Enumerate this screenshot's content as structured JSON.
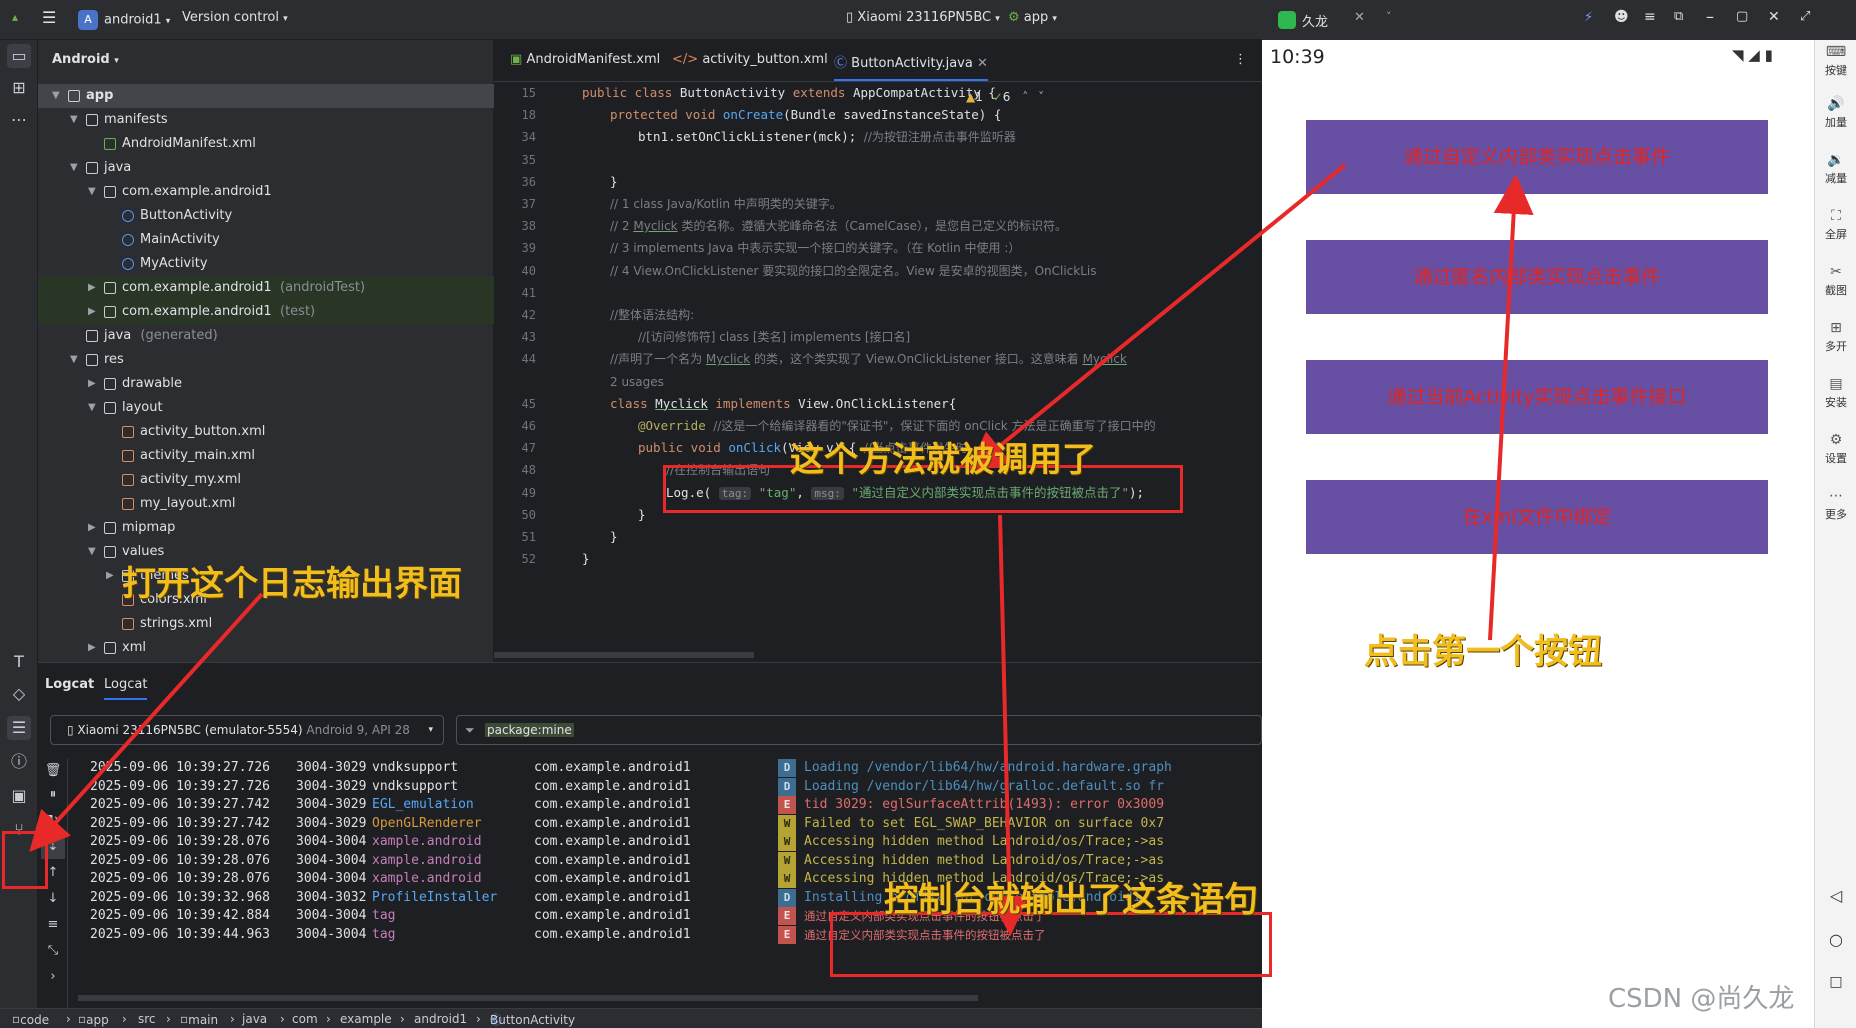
{
  "ide": {
    "project_name": "android1",
    "project_badge": "A",
    "version_control": "Version control",
    "device": "Xiaomi 23116PN5BC",
    "run_config": "app"
  },
  "project_panel": {
    "header": "Android",
    "tree": [
      {
        "label": "app",
        "extra": "",
        "indent": 0,
        "arrow": "open",
        "icon": "folder",
        "selected": true,
        "test": false
      },
      {
        "label": "manifests",
        "extra": "",
        "indent": 1,
        "arrow": "open",
        "icon": "folder",
        "selected": false,
        "test": false
      },
      {
        "label": "AndroidManifest.xml",
        "extra": "",
        "indent": 2,
        "arrow": "",
        "icon": "mf",
        "selected": false,
        "test": false
      },
      {
        "label": "java",
        "extra": "",
        "indent": 1,
        "arrow": "open",
        "icon": "folder",
        "selected": false,
        "test": false
      },
      {
        "label": "com.example.android1",
        "extra": "",
        "indent": 2,
        "arrow": "open",
        "icon": "folder",
        "selected": false,
        "test": false
      },
      {
        "label": "ButtonActivity",
        "extra": "",
        "indent": 3,
        "arrow": "",
        "icon": "cls",
        "selected": false,
        "test": false
      },
      {
        "label": "MainActivity",
        "extra": "",
        "indent": 3,
        "arrow": "",
        "icon": "cls",
        "selected": false,
        "test": false
      },
      {
        "label": "MyActivity",
        "extra": "",
        "indent": 3,
        "arrow": "",
        "icon": "cls",
        "selected": false,
        "test": false
      },
      {
        "label": "com.example.android1",
        "extra": "(androidTest)",
        "indent": 2,
        "arrow": "closed",
        "icon": "folder",
        "selected": false,
        "test": true
      },
      {
        "label": "com.example.android1",
        "extra": "(test)",
        "indent": 2,
        "arrow": "closed",
        "icon": "folder",
        "selected": false,
        "test": true
      },
      {
        "label": "java",
        "extra": "(generated)",
        "indent": 1,
        "arrow": "",
        "icon": "folder",
        "selected": false,
        "test": false
      },
      {
        "label": "res",
        "extra": "",
        "indent": 1,
        "arrow": "open",
        "icon": "folder",
        "selected": false,
        "test": false
      },
      {
        "label": "drawable",
        "extra": "",
        "indent": 2,
        "arrow": "closed",
        "icon": "folder",
        "selected": false,
        "test": false
      },
      {
        "label": "layout",
        "extra": "",
        "indent": 2,
        "arrow": "open",
        "icon": "folder",
        "selected": false,
        "test": false
      },
      {
        "label": "activity_button.xml",
        "extra": "",
        "indent": 3,
        "arrow": "",
        "icon": "xml",
        "selected": false,
        "test": false
      },
      {
        "label": "activity_main.xml",
        "extra": "",
        "indent": 3,
        "arrow": "",
        "icon": "xml",
        "selected": false,
        "test": false
      },
      {
        "label": "activity_my.xml",
        "extra": "",
        "indent": 3,
        "arrow": "",
        "icon": "xml",
        "selected": false,
        "test": false
      },
      {
        "label": "my_layout.xml",
        "extra": "",
        "indent": 3,
        "arrow": "",
        "icon": "xml",
        "selected": false,
        "test": false
      },
      {
        "label": "mipmap",
        "extra": "",
        "indent": 2,
        "arrow": "closed",
        "icon": "folder",
        "selected": false,
        "test": false
      },
      {
        "label": "values",
        "extra": "",
        "indent": 2,
        "arrow": "open",
        "icon": "folder",
        "selected": false,
        "test": false
      },
      {
        "label": "themes",
        "extra": "",
        "indent": 3,
        "arrow": "closed",
        "icon": "folder",
        "selected": false,
        "test": false
      },
      {
        "label": "colors.xml",
        "extra": "",
        "indent": 3,
        "arrow": "",
        "icon": "xml",
        "selected": false,
        "test": false
      },
      {
        "label": "strings.xml",
        "extra": "",
        "indent": 3,
        "arrow": "",
        "icon": "xml",
        "selected": false,
        "test": false
      },
      {
        "label": "xml",
        "extra": "",
        "indent": 2,
        "arrow": "closed",
        "icon": "folder",
        "selected": false,
        "test": false
      }
    ]
  },
  "editor": {
    "tabs": [
      "AndroidManifest.xml",
      "activity_button.xml",
      "ButtonActivity.java"
    ],
    "active_tab": 2,
    "inspections": {
      "warnings": "1",
      "ok": "6"
    },
    "lines": [
      {
        "n": "15",
        "html": "<span class='kw'>public class</span> ButtonActivity <span class='kw'>extends</span> AppCompatActivity {",
        "indent": 0
      },
      {
        "n": "18",
        "html": "<span class='kw'>protected void</span> <span class='fn'>onCreate</span>(Bundle savedInstanceState) {",
        "indent": 1
      },
      {
        "n": "34",
        "html": "btn1.setOnClickListener(mck);  <span class='cmtext'>//为按钮注册点击事件监听器</span>",
        "indent": 2
      },
      {
        "n": "35",
        "html": "",
        "indent": 0
      },
      {
        "n": "36",
        "html": "}",
        "indent": 1
      },
      {
        "n": "37",
        "html": "<span class='cmtext'>// 1    class   Java/Kotlin 中声明类的关键字。</span>",
        "indent": 1
      },
      {
        "n": "38",
        "html": "<span class='cmtext'>// 2    <span class='ul'>Myclick</span> 类的名称。遵循大驼峰命名法（CamelCase），是您自己定义的标识符。</span>",
        "indent": 1
      },
      {
        "n": "39",
        "html": "<span class='cmtext'>// 3    implements  Java 中表示实现一个接口的关键字。（在 Kotlin 中使用 :）</span>",
        "indent": 1
      },
      {
        "n": "40",
        "html": "<span class='cmtext'>// 4    View.OnClickListener    要实现的接口的全限定名。View 是安卓的视图类，OnClickLis</span>",
        "indent": 1
      },
      {
        "n": "41",
        "html": "",
        "indent": 0
      },
      {
        "n": "42",
        "html": "<span class='cmtext'>//整体语法结构:</span>",
        "indent": 1
      },
      {
        "n": "43",
        "html": "<span class='cmtext'>//[访问修饰符] class [类名] implements [接口名]</span>",
        "indent": 2
      },
      {
        "n": "44",
        "html": "<span class='cmtext'>//声明了一个名为 <span class='ul'>Myclick</span> 的类，这个类实现了 View.OnClickListener 接口。这意味着 <span class='ul'>Myclick</span></span>",
        "indent": 1
      },
      {
        "n": "",
        "html": "<span class='cmtext'>2 usages</span>",
        "indent": 1
      },
      {
        "n": "45",
        "html": "<span class='kw'>class</span> <span class='ul'>Myclick</span> <span class='kw'>implements</span> View.OnClickListener{",
        "indent": 1
      },
      {
        "n": "46",
        "html": "<span class='an'>@Override</span>  <span class='cmtext'>//这是一个给编译器看的\"保证书\"，保证下面的 onClick 方法是正确重写了接口中的</span>",
        "indent": 2
      },
      {
        "n": "47",
        "html": "<span class='kw'>public void</span> <span class='fn'>onClick</span>(View v) {  <span class='cmtext'>//当点击事件发生时，我会</span>",
        "indent": 2
      },
      {
        "n": "48",
        "html": "<span class='cmtext'>//在控制台输出语句</span>",
        "indent": 3
      },
      {
        "n": "49",
        "html": "Log.e( <span class='hint'>tag:</span> <span class='str'>\"tag\"</span>, <span class='hint'>msg:</span> <span class='str'>\"通过自定义内部类实现点击事件的按钮被点击了\"</span>);",
        "indent": 3
      },
      {
        "n": "50",
        "html": "}",
        "indent": 2
      },
      {
        "n": "51",
        "html": "}",
        "indent": 1
      },
      {
        "n": "52",
        "html": "}",
        "indent": 0
      }
    ]
  },
  "logcat": {
    "tabs": [
      "Logcat",
      "Logcat"
    ],
    "device": "Xiaomi 23116PN5BC (emulator-5554)",
    "device_extra": "Android 9, API 28",
    "filter": "package:mine",
    "rows": [
      {
        "time": "2025-09-06 10:39:27.726",
        "pid": "3004-3029",
        "tag": "vndksupport",
        "tagc": "plain",
        "pkg": "com.example.android1",
        "lvl": "D",
        "msg": "Loading /vendor/lib64/hw/android.hardware.graph"
      },
      {
        "time": "2025-09-06 10:39:27.726",
        "pid": "3004-3029",
        "tag": "vndksupport",
        "tagc": "plain",
        "pkg": "com.example.android1",
        "lvl": "D",
        "msg": "Loading /vendor/lib64/hw/gralloc.default.so fr"
      },
      {
        "time": "2025-09-06 10:39:27.742",
        "pid": "3004-3029",
        "tag": "EGL_emulation",
        "tagc": "blue",
        "pkg": "com.example.android1",
        "lvl": "E",
        "msg": "tid 3029: eglSurfaceAttrib(1493): error 0x3009"
      },
      {
        "time": "2025-09-06 10:39:27.742",
        "pid": "3004-3029",
        "tag": "OpenGLRenderer",
        "tagc": "orange",
        "pkg": "com.example.android1",
        "lvl": "W",
        "msg": "Failed to set EGL_SWAP_BEHAVIOR on surface 0x7"
      },
      {
        "time": "2025-09-06 10:39:28.076",
        "pid": "3004-3004",
        "tag": "xample.android",
        "tagc": "purple",
        "pkg": "com.example.android1",
        "lvl": "W",
        "msg": "Accessing hidden method Landroid/os/Trace;->as"
      },
      {
        "time": "2025-09-06 10:39:28.076",
        "pid": "3004-3004",
        "tag": "xample.android",
        "tagc": "purple",
        "pkg": "com.example.android1",
        "lvl": "W",
        "msg": "Accessing hidden method Landroid/os/Trace;->as"
      },
      {
        "time": "2025-09-06 10:39:28.076",
        "pid": "3004-3004",
        "tag": "xample.android",
        "tagc": "purple",
        "pkg": "com.example.android1",
        "lvl": "W",
        "msg": "Accessing hidden method Landroid/os/Trace;->as"
      },
      {
        "time": "2025-09-06 10:39:32.968",
        "pid": "3004-3032",
        "tag": "ProfileInstaller",
        "tagc": "blue",
        "pkg": "com.example.android1",
        "lvl": "D",
        "msg": "Installing profile for com.example.android1"
      },
      {
        "time": "2025-09-06 10:39:42.884",
        "pid": "3004-3004",
        "tag": "tag",
        "tagc": "purple",
        "pkg": "com.example.android1",
        "lvl": "E",
        "msg": "通过自定义内部类实现点击事件的按钮被点击了"
      },
      {
        "time": "2025-09-06 10:39:44.963",
        "pid": "3004-3004",
        "tag": "tag",
        "tagc": "purple",
        "pkg": "com.example.android1",
        "lvl": "E",
        "msg": "通过自定义内部类实现点击事件的按钮被点击了"
      }
    ]
  },
  "statusbar": {
    "crumbs": [
      "code",
      "app",
      "src",
      "main",
      "java",
      "com",
      "example",
      "android1",
      "ButtonActivity"
    ]
  },
  "emulator": {
    "title": "久龙",
    "time": "10:39",
    "buttons": [
      "通过自定义内部类实现点击事件",
      "通过匿名内部类实现点击事件",
      "通过当前Activity实现点击事件接口",
      "在xml文件中绑定"
    ],
    "side_tools": [
      "按键",
      "加量",
      "减量",
      "全屏",
      "截图",
      "多开",
      "安装",
      "设置",
      "更多"
    ]
  },
  "annotations": {
    "open_log": "打开这个日志输出界面",
    "method_called": "这个方法就被调用了",
    "console_output": "控制台就输出了这条语句",
    "click_first": "点击第一个按钮"
  },
  "watermark": "CSDN @尚久龙",
  "colors": {
    "button_bg": "#6750a4",
    "button_text": "#e2241f",
    "annotation": "#f2be1e",
    "highlight": "#e8292a"
  }
}
